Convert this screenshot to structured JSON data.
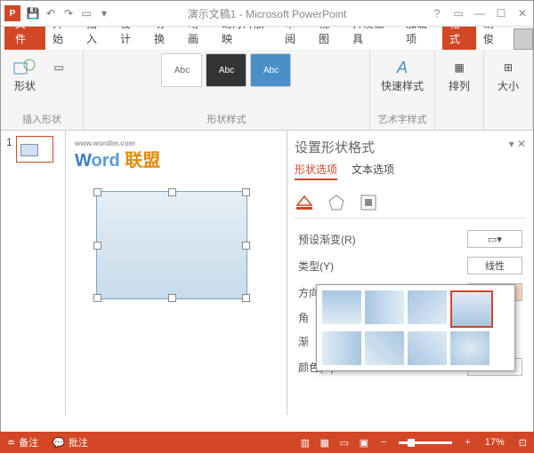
{
  "title": "演示文稿1 - Microsoft PowerPoint",
  "tabs": {
    "file": "文件",
    "start": "开始",
    "insert": "插入",
    "design": "设计",
    "trans": "切换",
    "anim": "动画",
    "slideshow": "幻灯片放映",
    "review": "审阅",
    "view": "视图",
    "dev": "开发工具",
    "addin": "加载项",
    "format": "格式",
    "user": "胡俊"
  },
  "ribbon": {
    "shapes": "形状",
    "insert_shape": "插入形状",
    "shape_styles": "形状样式",
    "abc": "Abc",
    "quickstyle": "快速样式",
    "wordart": "艺术字样式",
    "arrange": "排列",
    "size": "大小"
  },
  "slide_num": "1",
  "logo": {
    "word": "Word",
    "url": "www.wordlm.com",
    "cn": "联盟"
  },
  "pane": {
    "title": "设置形状格式",
    "tab1": "形状选项",
    "tab2": "文本选项",
    "preset": "预设渐变(R)",
    "type": "类型(Y)",
    "type_val": "线性",
    "direction": "方向(D)",
    "angle": "角",
    "grad": "渐",
    "color": "颜色(C)"
  },
  "status": {
    "notes": "备注",
    "comments": "批注",
    "zoom": "17%"
  }
}
